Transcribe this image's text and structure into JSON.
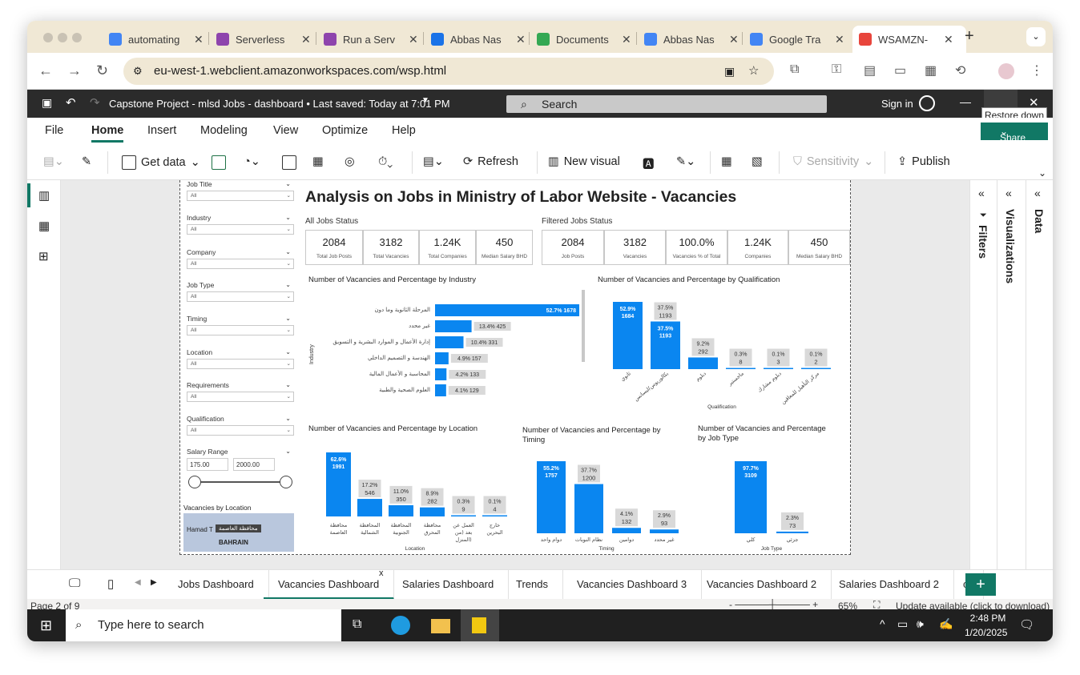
{
  "browser": {
    "tabs": [
      {
        "title": "automating",
        "color": "#4285f4"
      },
      {
        "title": "Serverless",
        "color": "#8e44ad"
      },
      {
        "title": "Run a Serv",
        "color": "#8e44ad"
      },
      {
        "title": "Abbas Nas",
        "color": "#1a73e8"
      },
      {
        "title": "Documents",
        "color": "#34a853"
      },
      {
        "title": "Abbas Nas",
        "color": "#4285f4"
      },
      {
        "title": "Google Tra",
        "color": "#4285f4"
      },
      {
        "title": "WSAMZN-",
        "color": "#e8453c"
      }
    ],
    "new_tab": "+",
    "url": "eu-west-1.webclient.amazonworkspaces.com/wsp.html"
  },
  "app": {
    "title": "Capstone Project - mlsd Jobs - dashboard • Last saved: Today at 7:01 PM",
    "search_placeholder": "Search",
    "sign_in": "Sign in",
    "tooltip": "Restore down",
    "share": "Share",
    "menu": [
      "File",
      "Home",
      "Insert",
      "Modeling",
      "View",
      "Optimize",
      "Help"
    ],
    "ribbon": {
      "get_data": "Get data",
      "refresh": "Refresh",
      "new_visual": "New visual",
      "sensitivity": "Sensitivity",
      "publish": "Publish"
    }
  },
  "panes": {
    "filters": "Filters",
    "visualizations": "Visualizations",
    "data": "Data"
  },
  "report": {
    "title": "Analysis on Jobs in Ministry of Labor Website - Vacancies",
    "all_status": "All Jobs Status",
    "filtered_status": "Filtered Jobs Status",
    "all_cards": [
      {
        "value": "2084",
        "label": "Total Job Posts"
      },
      {
        "value": "3182",
        "label": "Total Vacancies"
      },
      {
        "value": "1.24K",
        "label": "Total Companies"
      },
      {
        "value": "450",
        "label": "Median Salary BHD"
      }
    ],
    "filtered_cards": [
      {
        "value": "2084",
        "label": "Job Posts"
      },
      {
        "value": "3182",
        "label": "Vacancies"
      },
      {
        "value": "100.0%",
        "label": "Vacancies % of Total"
      },
      {
        "value": "1.24K",
        "label": "Companies"
      },
      {
        "value": "450",
        "label": "Median Salary BHD"
      }
    ],
    "slicers": [
      {
        "label": "Job Title",
        "value": "All"
      },
      {
        "label": "Industry",
        "value": "All"
      },
      {
        "label": "Company",
        "value": "All"
      },
      {
        "label": "Job Type",
        "value": "All"
      },
      {
        "label": "Timing",
        "value": "All"
      },
      {
        "label": "Location",
        "value": "All"
      },
      {
        "label": "Requirements",
        "value": "All"
      },
      {
        "label": "Qualification",
        "value": "All"
      }
    ],
    "salary": {
      "label": "Salary Range",
      "min": "175.00",
      "max": "2000.00"
    },
    "map": {
      "title": "Vacancies by Location",
      "label1": "محافظة العاصمة",
      "label2": "Hamad T",
      "label3": "BAHRAIN"
    }
  },
  "chart_data": [
    {
      "type": "bar",
      "title": "Number of Vacancies and Percentage by Industry",
      "ylabel": "Industry",
      "categories": [
        "المرحلة الثانوية وما دون",
        "غير محدد",
        "إدارة الأعمال و الموارد البشرية و التسويق",
        "الهندسة و التصميم الداخلي",
        "المحاسبة و الأعمال المالية",
        "العلوم الصحية والطبية"
      ],
      "values": [
        1678,
        425,
        331,
        157,
        133,
        129
      ],
      "pct": [
        "52.7%",
        "13.4%",
        "10.4%",
        "4.9%",
        "4.2%",
        "4.1%"
      ]
    },
    {
      "type": "bar",
      "title": "Number of Vacancies and Percentage by Qualification",
      "xlabel": "Qualification",
      "categories": [
        "ثانوي",
        "بكالوريوس/ليسانس",
        "دبلوم",
        "ماجستير",
        "دبلوم مشارك",
        "مركز التأهيل للمعاقين"
      ],
      "values": [
        1684,
        1193,
        292,
        8,
        3,
        2
      ],
      "pct": [
        "52.9%",
        "37.5%",
        "9.2%",
        "0.3%",
        "0.1%",
        "0.1%"
      ]
    },
    {
      "type": "bar",
      "title": "Number of Vacancies and Percentage by Location",
      "xlabel": "Location",
      "categories": [
        "محافظة العاصمة",
        "المحافظة الشمالية",
        "المحافظة الجنوبية",
        "محافظة المحرق",
        "العمل عن بعد (من المنزل)",
        "خارج البحرين"
      ],
      "values": [
        1991,
        546,
        350,
        282,
        9,
        4
      ],
      "pct": [
        "62.6%",
        "17.2%",
        "11.0%",
        "8.9%",
        "0.3%",
        "0.1%"
      ]
    },
    {
      "type": "bar",
      "title": "Number of Vacancies and Percentage by Timing",
      "xlabel": "Timing",
      "categories": [
        "دوام واحد",
        "نظام النوبات",
        "دوامين",
        "غير محدد"
      ],
      "values": [
        1757,
        1200,
        132,
        93
      ],
      "pct": [
        "55.2%",
        "37.7%",
        "4.1%",
        "2.9%"
      ]
    },
    {
      "type": "bar",
      "title": "Number of Vacancies and Percentage by Job Type",
      "xlabel": "Job Type",
      "categories": [
        "كلي",
        "جزئي"
      ],
      "values": [
        3109,
        73
      ],
      "pct": [
        "97.7%",
        "2.3%"
      ]
    }
  ],
  "pages": [
    "Jobs Dashboard",
    "Vacancies Dashboard",
    "Salaries Dashboard",
    "Trends",
    "Vacancies Dashboard 3",
    "Vacancies Dashboard 2",
    "Salaries Dashboard 2",
    "c"
  ],
  "status": {
    "page": "Page 2 of 9",
    "zoom": "65%",
    "update": "Update available (click to download)"
  },
  "taskbar": {
    "search_placeholder": "Type here to search",
    "time": "2:48 PM",
    "date": "1/20/2025"
  }
}
